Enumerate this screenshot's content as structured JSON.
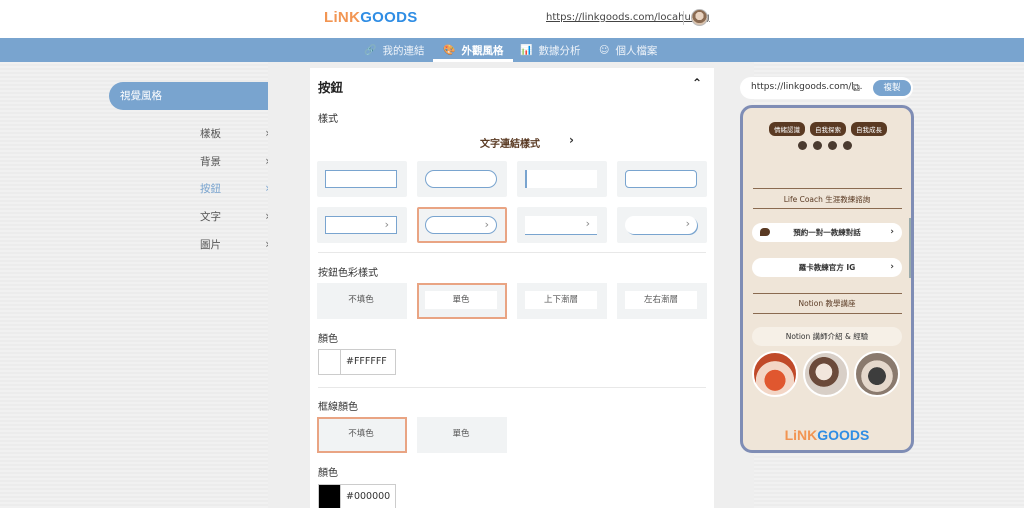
{
  "header": {
    "logo_part1": "LiNK",
    "logo_part2": "GOODS",
    "user_url": "https://linkgoods.com/locahuang"
  },
  "nav": {
    "items": [
      {
        "icon": "🔗",
        "label": "我的連結"
      },
      {
        "icon": "🎨",
        "label": "外觀風格"
      },
      {
        "icon": "📊",
        "label": "數據分析"
      },
      {
        "icon": "☺",
        "label": "個人檔案"
      }
    ]
  },
  "sidebar": {
    "main": "視覺風格",
    "items": [
      {
        "label": "樣板"
      },
      {
        "label": "背景"
      },
      {
        "label": "按鈕"
      },
      {
        "label": "文字"
      },
      {
        "label": "圖片"
      }
    ],
    "chevron": "›"
  },
  "panel": {
    "title": "按鈕",
    "caret": "⌃",
    "style_label": "樣式",
    "link_style": "文字連結樣式",
    "link_style_chevron": "›",
    "shape_arrow": "›",
    "color_style_label": "按鈕色彩樣式",
    "color_options": [
      "不填色",
      "單色",
      "上下漸層",
      "左右漸層"
    ],
    "color_label": "顏色",
    "color_hex": "#FFFFFF",
    "border_color_label": "框線顏色",
    "border_options": [
      "不填色",
      "單色"
    ],
    "border_color_label2": "顏色",
    "border_hex": "#000000"
  },
  "preview": {
    "url": "https://linkgoods.com/l...",
    "ext_icon": "⧉",
    "copy_label": "複製",
    "tags": [
      "情緒認識",
      "自我探索",
      "自我成長"
    ],
    "section1": "Life Coach 生涯教練諮詢",
    "link1": "預約一對一教練對話",
    "link2": "羅卡教練官方 IG",
    "section2": "Notion 教學講座",
    "link3": "Notion 講師介紹 & 經驗",
    "link_arrow": "›",
    "logo_part1": "LiNK",
    "logo_part2": "GOODS"
  },
  "colors": {
    "accent": "#79a4cf",
    "selected_border": "#e9a483",
    "brand_orange": "#f29552",
    "brand_blue": "#2f8de4",
    "phone_bg": "#efe5d8",
    "phone_brown": "#5a3a23"
  }
}
